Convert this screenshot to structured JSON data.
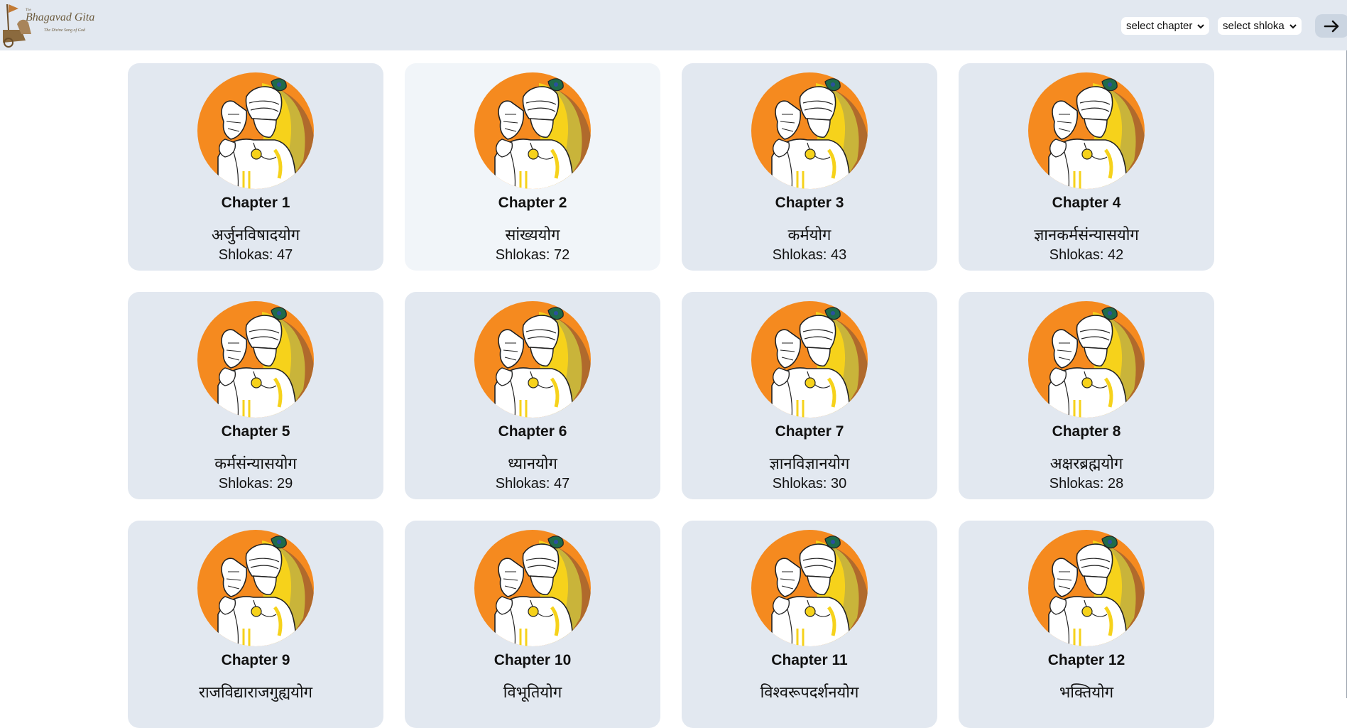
{
  "header": {
    "logo": {
      "the": "The",
      "title": "Bhagavad Gita",
      "subtitle": "The Divine Song of God"
    },
    "chapter_select": {
      "label": "select chapter"
    },
    "shloka_select": {
      "label": "select shloka"
    },
    "go_icon": "arrow-right-icon"
  },
  "colors": {
    "topbar": "#e2e8f0",
    "card": "#e2e8f0",
    "card_hover": "#f1f5f9",
    "art_orange": "#f58a1f",
    "art_yellow": "#f6d21b",
    "art_brown": "#b06a2c"
  },
  "chapters": [
    {
      "title": "Chapter 1",
      "name": "अर्जुनविषादयोग",
      "shlokas": "Shlokas: 47"
    },
    {
      "title": "Chapter 2",
      "name": "सांख्ययोग",
      "shlokas": "Shlokas: 72"
    },
    {
      "title": "Chapter 3",
      "name": "कर्मयोग",
      "shlokas": "Shlokas: 43"
    },
    {
      "title": "Chapter 4",
      "name": "ज्ञानकर्मसंन्यासयोग",
      "shlokas": "Shlokas: 42"
    },
    {
      "title": "Chapter 5",
      "name": "कर्मसंन्यासयोग",
      "shlokas": "Shlokas: 29"
    },
    {
      "title": "Chapter 6",
      "name": "ध्यानयोग",
      "shlokas": "Shlokas: 47"
    },
    {
      "title": "Chapter 7",
      "name": "ज्ञानविज्ञानयोग",
      "shlokas": "Shlokas: 30"
    },
    {
      "title": "Chapter 8",
      "name": "अक्षरब्रह्मयोग",
      "shlokas": "Shlokas: 28"
    },
    {
      "title": "Chapter 9",
      "name": "राजविद्याराजगुह्ययोग",
      "shlokas": ""
    },
    {
      "title": "Chapter 10",
      "name": "विभूतियोग",
      "shlokas": ""
    },
    {
      "title": "Chapter 11",
      "name": "विश्वरूपदर्शनयोग",
      "shlokas": ""
    },
    {
      "title": "Chapter 12",
      "name": "भक्तियोग",
      "shlokas": ""
    }
  ]
}
